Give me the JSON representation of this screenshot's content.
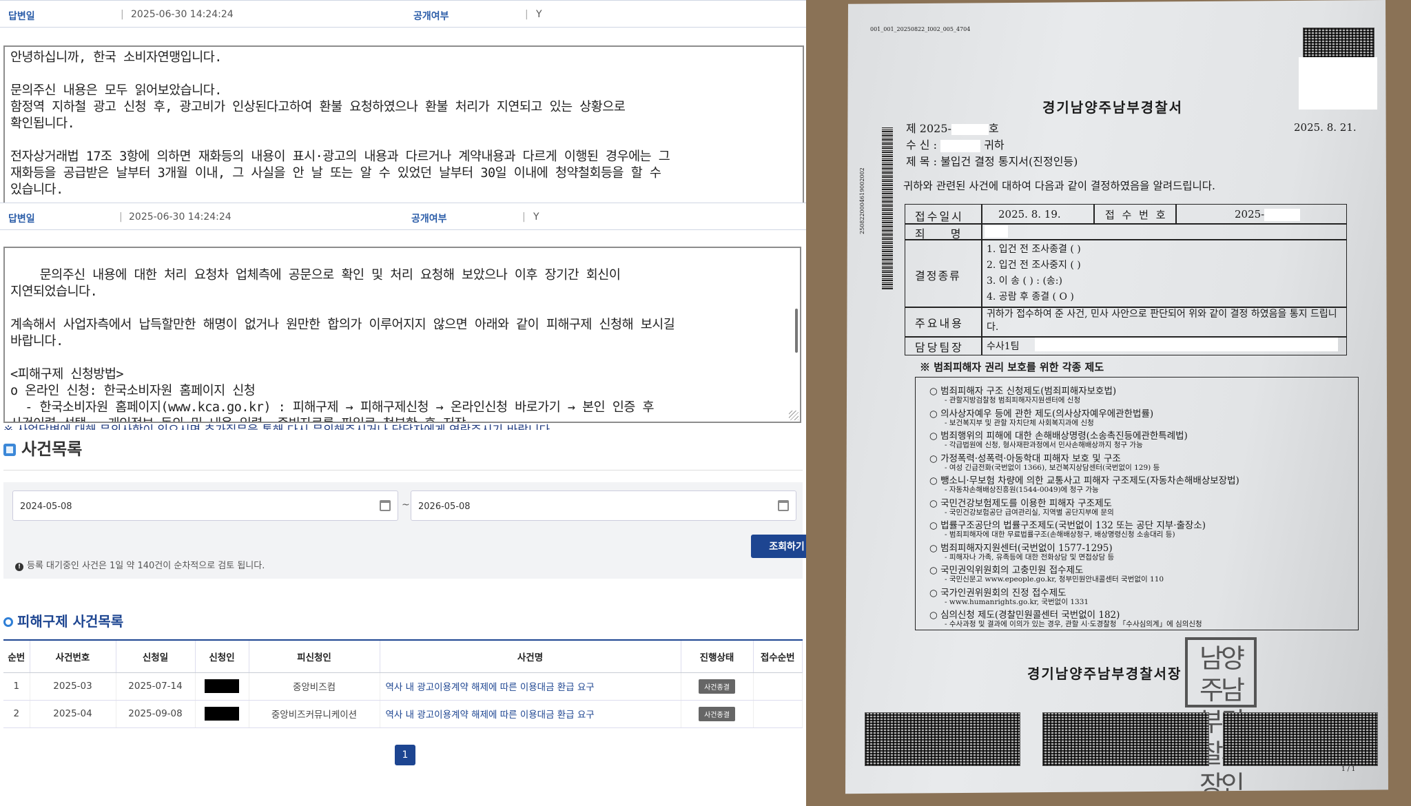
{
  "answer1": {
    "label": "답변일",
    "date": "2025-06-30 14:24:24",
    "public_label": "공개여부",
    "public_value": "Y",
    "text": "안녕하십니까, 한국 소비자연맹입니다.\n\n문의주신 내용은 모두 읽어보았습니다.\n함정역 지하철 광고 신청 후, 광고비가 인상된다고하여 환불 요청하였으나 환불 처리가 지연되고 있는 상황으로\n확인됩니다.\n\n전자상거래법 17조 3항에 의하면 재화등의 내용이 표시·광고의 내용과 다르거나 계약내용과 다르게 이행된 경우에는 그\n재화등을 공급받은 날부터 3개월 이내, 그 사실을 안 날 또는 알 수 있었던 날부터 30일 이내에 청약철회등을 할 수\n있습니다."
  },
  "answer2": {
    "label": "답변일",
    "date": "2025-06-30 14:24:24",
    "public_label": "공개여부",
    "public_value": "Y",
    "text": "문의주신 내용에 대한 처리 요청차 업체측에 공문으로 확인 및 처리 요청해 보았으나 이후 장기간 회신이\n지연되었습니다.\n\n계속해서 사업자측에서 납득할만한 해명이 없거나 원만한 합의가 이루어지지 않으면 아래와 같이 피해구제 신청해 보시길\n바랍니다.\n\n<피해구제 신청방법>\no 온라인 신청: 한국소비자원 홈페이지 신청\n  - 한국소비자원 홈페이지(www.kca.go.kr) : 피해구제 → 피해구제신청 → 온라인신청 바로가기 → 본인 인증 후\n사건이력 선택 → 개인정보 동의 및 내용 입력, 증빙자료를 파일로 첨부한 후 저장"
  },
  "overlap_text": "※ 사업답변에 대해 문의사항이 있으시면 추가질문을 통해 다시 문의해주시거나 담당자에게 연락주시기 바랍니다.",
  "case_list": {
    "title": "사건목록",
    "date_from": "2024-05-08",
    "date_to": "2026-05-08",
    "tilde": "~",
    "search_button": "조회하기",
    "note": "등록 대기중인 사건은 1일 약 140건이 순차적으로 검토 됩니다."
  },
  "relief_list": {
    "title": "피해구제 사건목록",
    "columns": [
      "순번",
      "사건번호",
      "신청일",
      "신청인",
      "피신청인",
      "사건명",
      "진행상태",
      "접수순번"
    ],
    "rows": [
      {
        "no": "1",
        "case_no": "2025-03",
        "date": "2025-07-14",
        "respondent": "중앙비즈컴",
        "title": "역사 내 광고이용계약 해제에 따른 이용대금 환급 요구",
        "status": "사건종결",
        "order": ""
      },
      {
        "no": "2",
        "case_no": "2025-04",
        "date": "2025-09-08",
        "respondent": "중앙비즈커뮤니케이션",
        "title": "역사 내 광고이용계약 해제에 따른 이용대금 환급 요구",
        "status": "사건종결",
        "order": ""
      }
    ],
    "page": "1"
  },
  "letter": {
    "doc_code": "001_001_20250822_I002_005_4704",
    "side_code": "2508220004619002002",
    "agency": "경기남양주남부경찰서",
    "no_prefix": "제 2025-",
    "no_suffix": "호",
    "date": "2025. 8. 21.",
    "to_label": "수 신 :",
    "to_suffix": "귀하",
    "subject": "제 목 : 불입건 결정 통지서(진정인등)",
    "intro": "귀하와 관련된 사건에 대하여 다음과 같이 결정하였음을 알려드립니다.",
    "table": {
      "received_label": "접수일시",
      "received_value": "2025. 8. 19.",
      "receipt_no_label": "접 수 번 호",
      "receipt_no_value": "2025-",
      "crime_label": "죄 명",
      "decision_label": "결정종류",
      "decisions": [
        "1. 입건 전 조사종결 (  )",
        "2. 입건 전 조사중지 (  )",
        "3. 이    송 (  ) : (송:)",
        "4. 공람 후 종결 ( O )"
      ],
      "content_label": "주요내용",
      "content_value": "귀하가 접수하여 준 사건, 민사 사안으로 판단되어 위와 같이 결정 하였음을 통지 드립니다.",
      "officer_label": "담당팀장",
      "officer_value": "수사1팀"
    },
    "rights_title": "※ 범죄피해자 권리 보호를 위한 각종 제도",
    "rights": [
      {
        "main": "○ 범죄피해자 구조 신청제도(범죄피해자보호법)",
        "sub": "- 관할지방검찰청 범죄피해자지원센터에 신청"
      },
      {
        "main": "○ 의사상자예우 등에 관한 제도(의사상자예우에관한법률)",
        "sub": "- 보건복지부 및 관할 자치단체 사회복지과에 신청"
      },
      {
        "main": "○ 범죄행위의 피해에 대한 손해배상명령(소송촉진등에관한특례법)",
        "sub": "- 각급법원에 신청, 형사재판과정에서 민사손해배상까지 청구 가능"
      },
      {
        "main": "○ 가정폭력·성폭력·아동학대 피해자 보호 및 구조",
        "sub": "- 여성 긴급전화(국번없이 1366), 보건복지상담센터(국번없이 129) 등"
      },
      {
        "main": "○ 뺑소니·무보험 차량에 의한 교통사고 피해자 구조제도(자동차손해배상보장법)",
        "sub": "- 자동차손해배상진흥원(1544-0049)에 청구 가능"
      },
      {
        "main": "○ 국민건강보험제도를 이용한 피해자 구조제도",
        "sub": "- 국민건강보험공단 급여관리실, 지역별 공단지부에 문의"
      },
      {
        "main": "○ 법률구조공단의 법률구조제도(국번없이 132 또는 공단 지부·출장소)",
        "sub": "- 범죄피해자에 대한 무료법률구조(손해배상청구, 배상명령신청 소송대리 등)"
      },
      {
        "main": "○ 범죄피해자지원센터(국번없이 1577-1295)",
        "sub": "- 피해자나 가족, 유족등에 대한 전화상담 및 면접상담 등"
      },
      {
        "main": "○ 국민권익위원회의 고충민원 접수제도",
        "sub": "- 국민신문고 www.epeople.go.kr, 정부민원안내콜센터 국번없이 110"
      },
      {
        "main": "○ 국가인권위원회의 진정 접수제도",
        "sub": "- www.humanrights.go.kr, 국번없이 1331"
      },
      {
        "main": "○ 심의신청 제도(경찰민원콜센터 국번없이 182)",
        "sub": "- 수사과정 및 결과에 이의가 있는 경우, 관할 시·도경찰청 「수사심의계」에 심의신청"
      }
    ],
    "footer": "경기남양주남부경찰서장",
    "seal": "남양주남부경찰서장인",
    "page": "1 / 1"
  }
}
